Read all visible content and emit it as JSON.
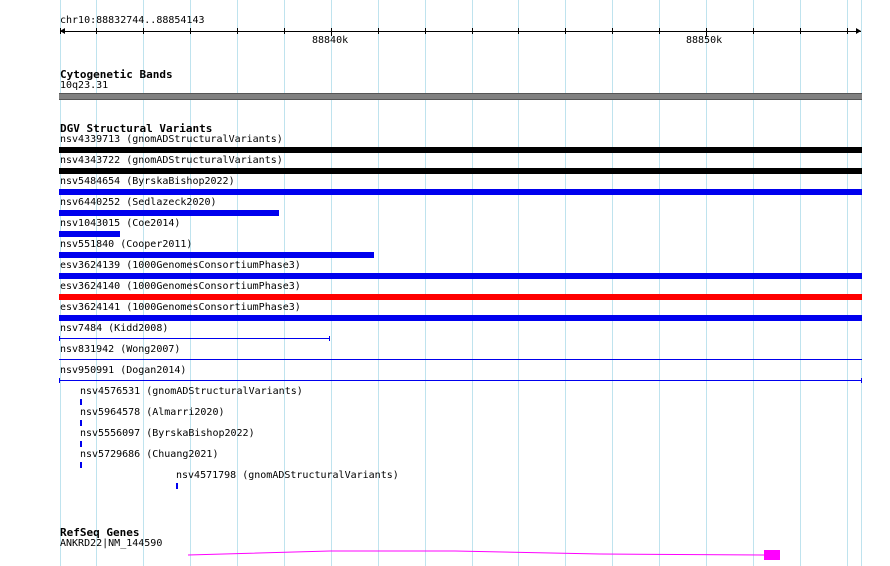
{
  "ruler": {
    "location": "chr10:88832744..88854143",
    "ticks": [
      "88840k",
      "88850k"
    ]
  },
  "tracks": {
    "cytoband": {
      "title": "Cytogenetic Bands",
      "band": "10q23.31",
      "color": "#808080"
    },
    "dgv": {
      "title": "DGV Structural Variants",
      "features": [
        {
          "label": "nsv4339713 (gnomADStructuralVariants)",
          "color": "#000000",
          "style": "thick"
        },
        {
          "label": "nsv4343722 (gnomADStructuralVariants)",
          "color": "#000000",
          "style": "thick"
        },
        {
          "label": "nsv5484654 (ByrskaBishop2022)",
          "color": "#0000ee",
          "style": "thick"
        },
        {
          "label": "nsv6440252 (Sedlazeck2020)",
          "color": "#0000ee",
          "style": "thick"
        },
        {
          "label": "nsv1043015 (Coe2014)",
          "color": "#0000ee",
          "style": "thick"
        },
        {
          "label": "nsv551840 (Cooper2011)",
          "color": "#0000ee",
          "style": "thick"
        },
        {
          "label": "esv3624139 (1000GenomesConsortiumPhase3)",
          "color": "#0000ee",
          "style": "thick"
        },
        {
          "label": "esv3624140 (1000GenomesConsortiumPhase3)",
          "color": "#ff0000",
          "style": "thick"
        },
        {
          "label": "esv3624141 (1000GenomesConsortiumPhase3)",
          "color": "#0000ee",
          "style": "thick"
        },
        {
          "label": "nsv7484 (Kidd2008)",
          "color": "#0000ee",
          "style": "thin-ends"
        },
        {
          "label": "nsv831942 (Wong2007)",
          "color": "#0000ee",
          "style": "thin"
        },
        {
          "label": "nsv950991 (Dogan2014)",
          "color": "#0000ee",
          "style": "thin-ends"
        },
        {
          "label": "nsv4576531 (gnomADStructuralVariants)",
          "color": "#0000ee",
          "style": "tick"
        },
        {
          "label": "nsv5964578 (Almarri2020)",
          "color": "#0000ee",
          "style": "tick"
        },
        {
          "label": "nsv5556097 (ByrskaBishop2022)",
          "color": "#0000ee",
          "style": "tick"
        },
        {
          "label": "nsv5729686 (Chuang2021)",
          "color": "#0000ee",
          "style": "tick"
        },
        {
          "label": "nsv4571798 (gnomADStructuralVariants)",
          "color": "#0000ee",
          "style": "tick"
        }
      ]
    },
    "refseq": {
      "title": "RefSeq Genes",
      "gene": "ANKRD22|NM_144590",
      "color": "#ff00ff"
    }
  }
}
